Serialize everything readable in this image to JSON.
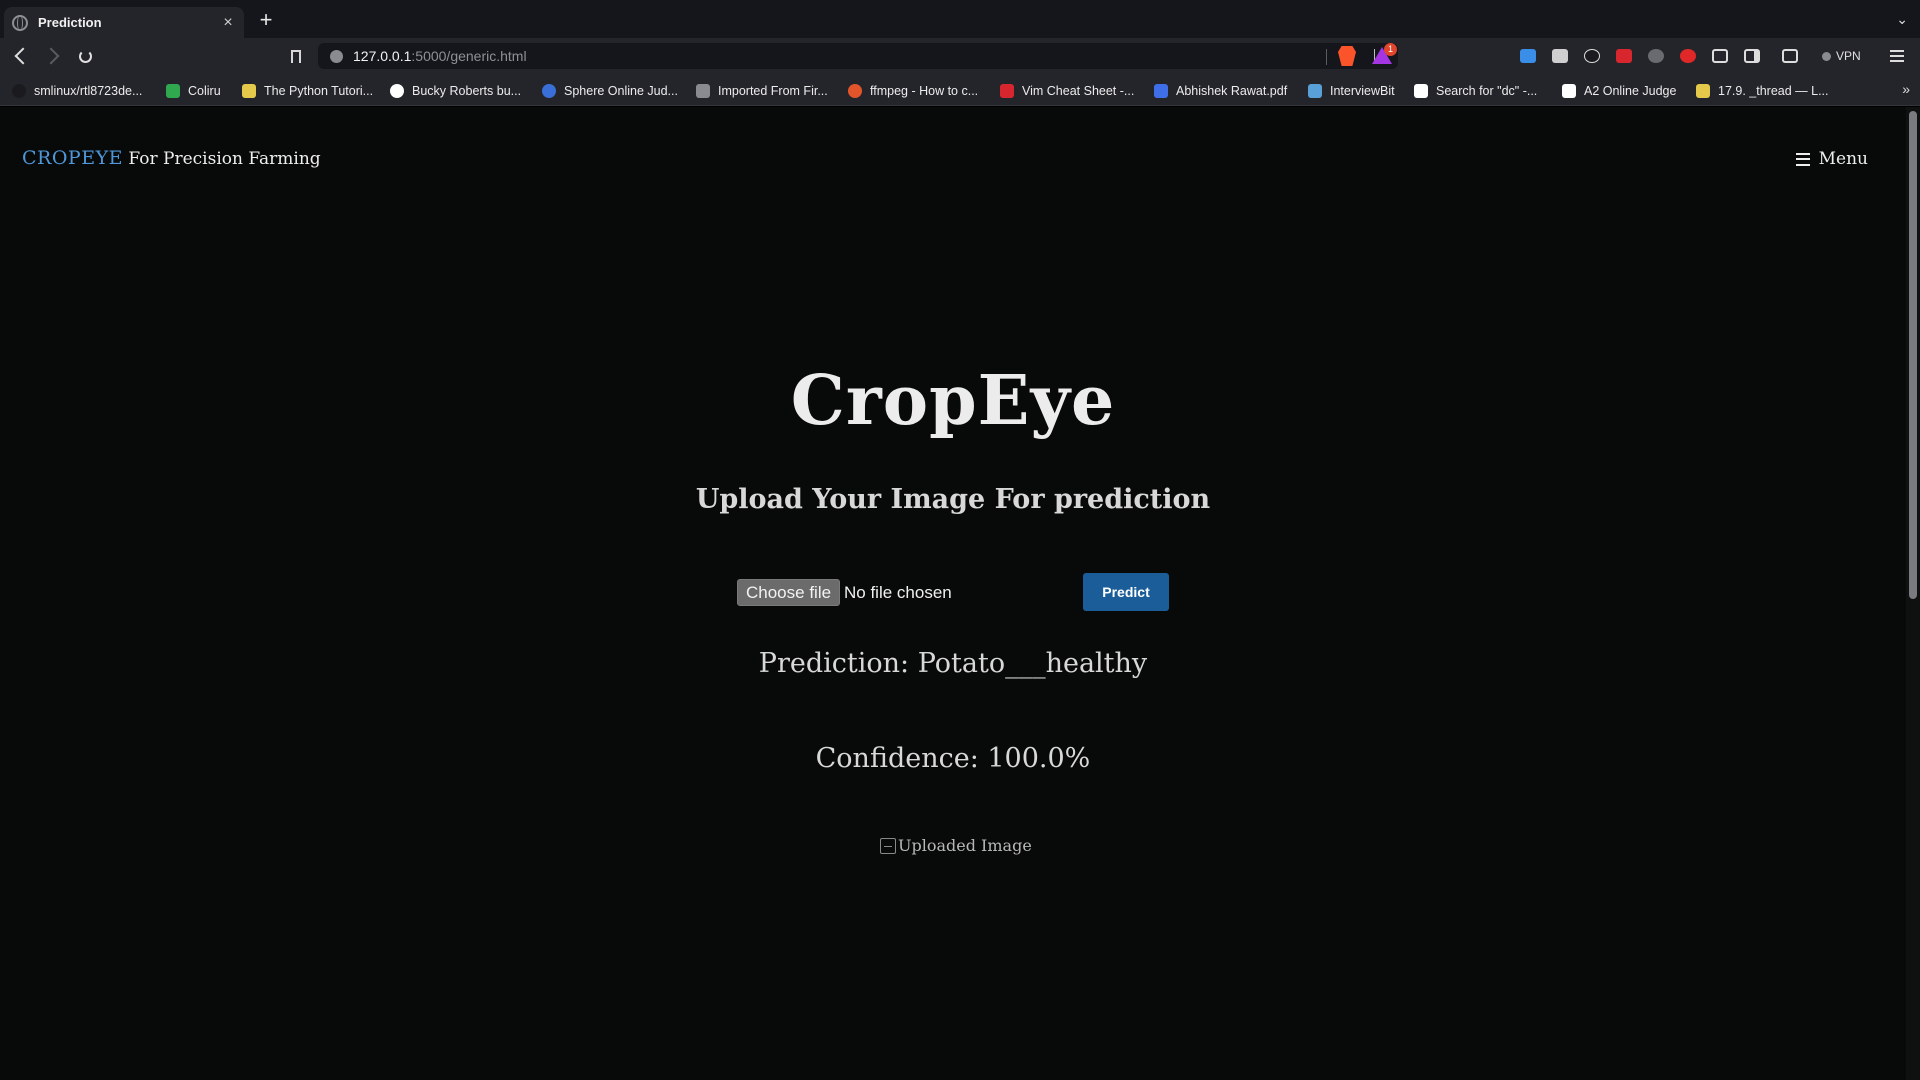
{
  "browser": {
    "tab": {
      "title": "Prediction",
      "close": "×"
    },
    "new_tab": "+",
    "tab_list": "⌄",
    "url": {
      "host": "127.0.0.1",
      "path": ":5000/generic.html"
    },
    "rewards_badge": "1",
    "vpn_label": "VPN",
    "bookmarks": [
      {
        "label": "smlinux/rtl8723de...",
        "color": "#1b1b1f"
      },
      {
        "label": "Coliru",
        "color": "#2fa84f"
      },
      {
        "label": "The Python Tutori...",
        "color": "#e4c94a"
      },
      {
        "label": "Bucky Roberts bu...",
        "color": "#ffffff"
      },
      {
        "label": "Sphere Online Jud...",
        "color": "#3a6fd8"
      },
      {
        "label": "Imported From Fir...",
        "color": "#8a8b90"
      },
      {
        "label": "ffmpeg - How to c...",
        "color": "#e2552b"
      },
      {
        "label": "Vim Cheat Sheet -...",
        "color": "#d8262e"
      },
      {
        "label": "Abhishek Rawat.pdf",
        "color": "#3f6fe8"
      },
      {
        "label": "InterviewBit",
        "color": "#5aa0d8"
      },
      {
        "label": "Search for \"dc\" -...",
        "color": "#ffffff"
      },
      {
        "label": "A2 Online Judge",
        "color": "#ffffff"
      },
      {
        "label": "17.9. _thread — L...",
        "color": "#e4c94a"
      }
    ],
    "bookmarks_more": "»"
  },
  "page": {
    "logo_brand": "CROPEYE",
    "logo_tagline": " For Precision Farming",
    "menu_label": "Menu",
    "title": "CropEye",
    "subtitle": "Upload Your Image For prediction",
    "file_button": "Choose file",
    "file_status": "No file chosen",
    "predict_button": "Predict",
    "prediction": "Prediction: Potato___healthy",
    "confidence": "Confidence: 100.0%",
    "uploaded_alt": "Uploaded Image"
  },
  "colors": {
    "brand": "#4f96d8",
    "predict_button": "#1a5d99",
    "page_bg": "#080909"
  }
}
